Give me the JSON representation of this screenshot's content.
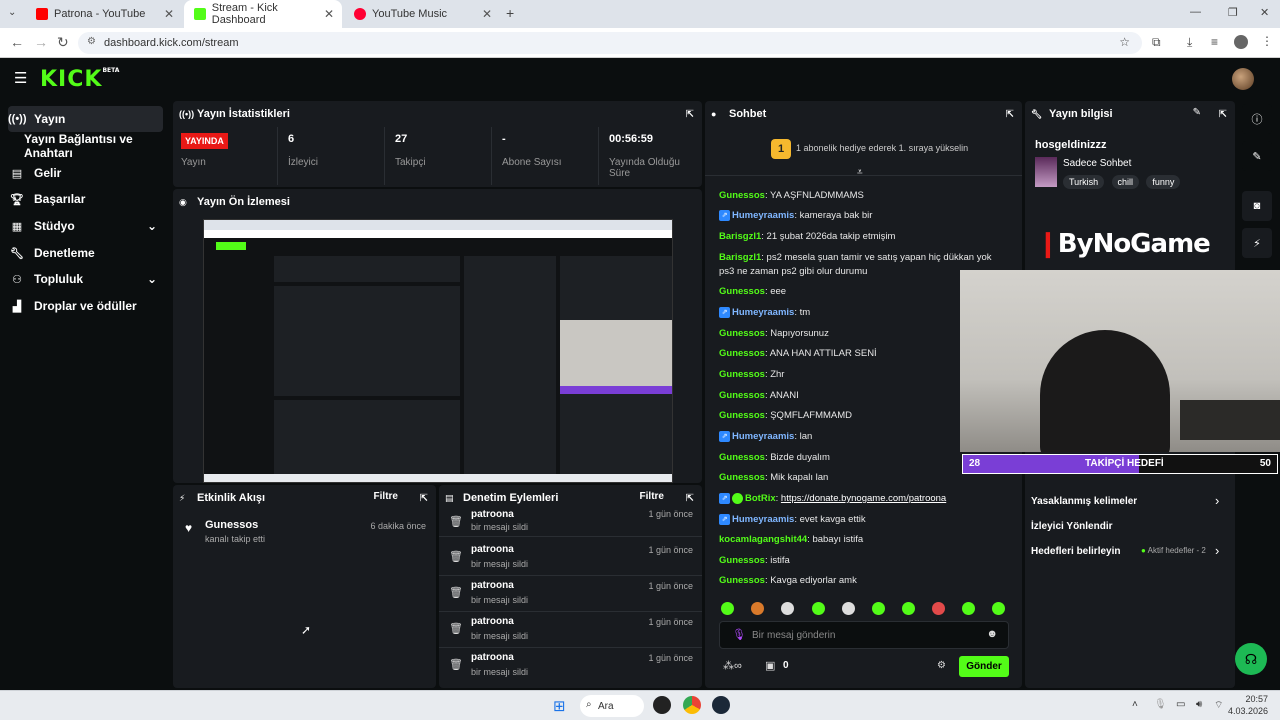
{
  "browser": {
    "tabs": [
      {
        "title": "Patrona - YouTube",
        "color": "#ff0000"
      },
      {
        "title": "Stream - Kick Dashboard",
        "color": "#53fc18"
      },
      {
        "title": "YouTube Music",
        "color": "#ff0033"
      }
    ],
    "url": "dashboard.kick.com/stream"
  },
  "header": {
    "logo": "KICK",
    "beta": "BETA"
  },
  "sidebar": {
    "items": [
      {
        "label": "Yayın",
        "icon": "broadcast-icon"
      },
      {
        "label": "Yayın Bağlantısı ve Anahtarı",
        "icon": ""
      },
      {
        "label": "Gelir",
        "icon": "revenue-icon"
      },
      {
        "label": "Başarılar",
        "icon": "trophy-icon"
      },
      {
        "label": "Stüdyo",
        "icon": "studio-icon"
      },
      {
        "label": "Denetleme",
        "icon": "wrench-icon"
      },
      {
        "label": "Topluluk",
        "icon": "community-icon"
      },
      {
        "label": "Droplar ve ödüller",
        "icon": "drops-icon"
      }
    ]
  },
  "stats": {
    "title": "Yayın İstatistikleri",
    "live_badge": "YAYINDA",
    "items": [
      {
        "value": "",
        "label": "Yayın"
      },
      {
        "value": "6",
        "label": "İzleyici"
      },
      {
        "value": "27",
        "label": "Takipçi"
      },
      {
        "value": "-",
        "label": "Abone Sayısı"
      },
      {
        "value": "00:56:59",
        "label": "Yayında Olduğu Süre"
      }
    ]
  },
  "preview": {
    "title": "Yayın Ön İzlemesi"
  },
  "activity": {
    "title": "Etkinlik Akışı",
    "filter": "Filtre",
    "events": [
      {
        "user": "Gunessos",
        "text": "kanalı takip etti",
        "time": "6 dakika önce"
      }
    ]
  },
  "moderation": {
    "title": "Denetim Eylemleri",
    "filter": "Filtre",
    "rows": [
      {
        "user": "patroona",
        "text": "bir mesajı sildi",
        "time": "1 gün önce"
      },
      {
        "user": "patroona",
        "text": "bir mesajı sildi",
        "time": "1 gün önce"
      },
      {
        "user": "patroona",
        "text": "bir mesajı sildi",
        "time": "1 gün önce"
      },
      {
        "user": "patroona",
        "text": "bir mesajı sildi",
        "time": "1 gün önce"
      },
      {
        "user": "patroona",
        "text": "bir mesajı sildi",
        "time": "1 gün önce"
      }
    ]
  },
  "chat": {
    "title": "Sohbet",
    "gift_banner": "1 abonelik hediye ederek 1. sıraya yükselin",
    "gift_rank": "1",
    "messages": [
      {
        "user": "Gunessos",
        "text": "YA AŞFNLADMMAMS",
        "badge": false
      },
      {
        "user": "Humeyraamis",
        "text": "kameraya bak bir",
        "badge": true
      },
      {
        "user": "Barisgzl1",
        "text": "21 şubat 2026da takip etmişim",
        "badge": false
      },
      {
        "user": "Barisgzl1",
        "text": "ps2 mesela şuan tamir ve satış yapan hiç dükkan yok ps3 ne zaman ps2 gibi olur durumu",
        "badge": false
      },
      {
        "user": "Gunessos",
        "text": "eee",
        "badge": false
      },
      {
        "user": "Humeyraamis",
        "text": "tm",
        "badge": true
      },
      {
        "user": "Gunessos",
        "text": "Napıyorsunuz",
        "badge": false
      },
      {
        "user": "Gunessos",
        "text": "ANA HAN ATTILAR SENİ",
        "badge": false
      },
      {
        "user": "Gunessos",
        "text": "Zhr",
        "badge": false
      },
      {
        "user": "Gunessos",
        "text": "ANANI",
        "badge": false
      },
      {
        "user": "Gunessos",
        "text": "ŞQMFLAFMMAMD",
        "badge": false
      },
      {
        "user": "Humeyraamis",
        "text": "lan",
        "badge": true
      },
      {
        "user": "Gunessos",
        "text": "Bizde duyalım",
        "badge": false
      },
      {
        "user": "Gunessos",
        "text": "Mik kapalı lan",
        "badge": false
      },
      {
        "user": "BotRix",
        "text": "https://donate.bynogame.com/patroona",
        "badge": true,
        "bot": true
      },
      {
        "user": "Humeyraamis",
        "text": "evet kavga ettik",
        "badge": true
      },
      {
        "user": "kocamlagangshit44",
        "text": "babayı istifa",
        "badge": false
      },
      {
        "user": "Gunessos",
        "text": "istifa",
        "badge": false
      },
      {
        "user": "Gunessos",
        "text": "Kavga ediyorlar amk",
        "badge": false
      }
    ],
    "input_placeholder": "Bir mesaj gönderin",
    "points": "0",
    "send_label": "Gönder"
  },
  "info": {
    "title": "Yayın bilgisi",
    "stream_title": "hosgeldinizzz",
    "category": "Sadece Sohbet",
    "tags": [
      "Turkish",
      "chill",
      "funny"
    ],
    "rows": [
      {
        "label": "Yasaklanmış kelimeler",
        "extra": ""
      },
      {
        "label": "İzleyici Yönlendir",
        "extra": ""
      },
      {
        "label": "Hedefleri belirleyin",
        "extra": "Aktif hedefler - 2"
      }
    ]
  },
  "overlay": {
    "sponsor": "ByNoGame",
    "goal_current": "28",
    "goal_label": "TAKİPÇİ HEDEFİ",
    "goal_target": "50",
    "goal_fraction": 0.56
  },
  "taskbar": {
    "search": "Ara",
    "time": "20:57",
    "date": "4.03.2026"
  },
  "colors": {
    "accent": "#53fc18",
    "live": "#e91916",
    "goal": "#7a3ed6"
  }
}
